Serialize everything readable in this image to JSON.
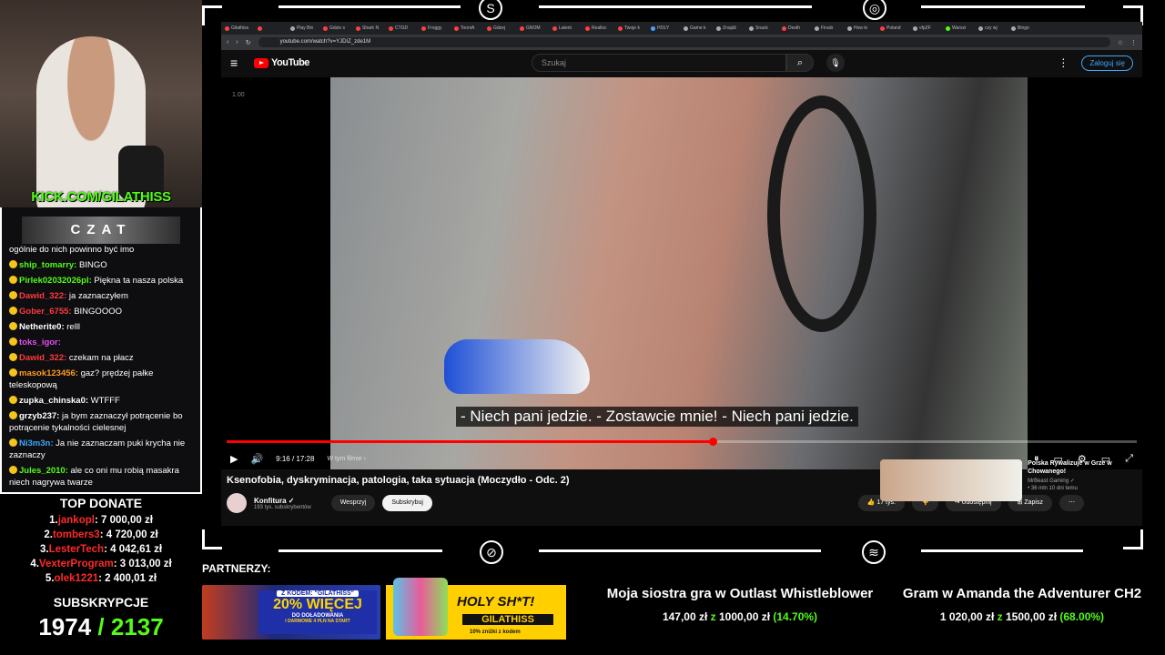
{
  "streamer": {
    "kick_handle": "KICK.COM/GILATHISS"
  },
  "chat": {
    "title": "CZAT",
    "messages": [
      {
        "user": "",
        "text": "ogólnie do nich powinno być imo",
        "color": "#ffffff"
      },
      {
        "user": "ship_tomarry:",
        "text": " BINGO",
        "color": "#53fc18"
      },
      {
        "user": "Pirlek02032026pl:",
        "text": " Piękna ta nasza polska",
        "color": "#53fc18"
      },
      {
        "user": "Dawid_322:",
        "text": " ja zaznaczyłem",
        "color": "#ff3b3b"
      },
      {
        "user": "Gober_6755:",
        "text": " BINGOOOO",
        "color": "#ff3b3b"
      },
      {
        "user": "Netherite0:",
        "text": " relll",
        "color": "#ffffff"
      },
      {
        "user": "toks_igor:",
        "text": "",
        "color": "#e44ef2"
      },
      {
        "user": "Dawid_322:",
        "text": " czekam na płacz",
        "color": "#ff3b3b"
      },
      {
        "user": "masok123456:",
        "text": " gaz? prędzej pałke teleskopową",
        "color": "#ff9a1f"
      },
      {
        "user": "zupka_chinska0:",
        "text": " WTFFF",
        "color": "#ffffff"
      },
      {
        "user": "grzyb237:",
        "text": " ja bym zaznaczył potrącenie bo potrącenie tykalności cielesnej",
        "color": "#ffffff"
      },
      {
        "user": "Ni3m3n:",
        "text": " Ja nie zaznaczam puki krycha nie zaznaczy",
        "color": "#3da9ff"
      },
      {
        "user": "Jules_2010:",
        "text": " ale co oni mu robią masakra niech nagrywa twarze",
        "color": "#53fc18"
      }
    ]
  },
  "top_donate": {
    "title": "TOP DONATE",
    "entries": [
      {
        "rank": "1.",
        "name": "jankopl",
        "amount": ": 7 000,00 zł"
      },
      {
        "rank": "2.",
        "name": "tombers3",
        "amount": ": 4 720,00 zł"
      },
      {
        "rank": "3.",
        "name": "LesterTech",
        "amount": ": 4 042,61 zł"
      },
      {
        "rank": "4.",
        "name": "VexterProgram",
        "amount": ": 3 013,00 zł"
      },
      {
        "rank": "5.",
        "name": "olek1221",
        "amount": ": 2 400,01 zł"
      }
    ]
  },
  "subs": {
    "title": "SUBSKRYPCJE",
    "current": "1974",
    "goal": " / 2137"
  },
  "browser": {
    "tabs": [
      "Gilathiss",
      "",
      "Play Bin",
      "Gdzie s",
      "Shark N",
      "CTGD",
      "Froggy",
      "TooniA",
      "Gdzej",
      "GNOM",
      "Latent",
      "Realloc",
      "Twoje k",
      "HOLY",
      "Game k",
      "Znajdź",
      "Snack",
      "Desth",
      "Finals",
      "How ki",
      "Poland",
      "vfpZF",
      "Warszi",
      "czy wj",
      "Bingo"
    ],
    "url": "youtube.com/watch?v=YJDIZ_zde1M"
  },
  "youtube": {
    "logo": "YouTube",
    "search_placeholder": "Szukaj",
    "signin": "Zaloguj się",
    "quality_tag": "1.00",
    "subtitle": "- Niech pani jedzie. - Zostawcie mnie! - Niech pani jedzie.",
    "progress": 0.534,
    "time": "9:16 / 17:28",
    "chapter": "W tym filmie ›",
    "video_title": "Ksenofobia, dyskryminacja, patologia, taka sytuacja (Moczydło - Odc. 2)",
    "channel_name": "Konfitura ✓",
    "channel_subs": "193 tys. subskrybentów",
    "support": "Wesprzyj",
    "subscribe": "Subskrybuj",
    "likes": "17 tys.",
    "share": "Udostępnij",
    "save": "Zapisz",
    "rec_title": "Polska Rywalizuje w Grze w Chowanego!",
    "rec_channel": "MrBeast Gaming ✓",
    "rec_meta": "• 36 mln  10 dni temu"
  },
  "partners": {
    "label": "PARTNERZY:",
    "banner1": {
      "code": "Z KODEM: \"GILATHISS\"",
      "big": "20% WIĘCEJ",
      "line2": "DO DOŁADOWANIA",
      "small": "I DARMOWE 4 PLN NA START"
    },
    "banner2": {
      "big": "HOLY SH*T!",
      "code": "GILATHISS",
      "small": "10% zniżki z kodem"
    }
  },
  "goals": [
    {
      "title": "Moja siostra gra w Outlast Whistleblower",
      "current": "147,00 zł",
      "of": " z ",
      "target": "1000,00 zł",
      "pct": " (14.70%)"
    },
    {
      "title": "Gram w Amanda the Adventurer CH2",
      "current": "1 020,00 zł",
      "of": " z ",
      "target": "1500,00 zł",
      "pct": " (68.00%)"
    }
  ]
}
